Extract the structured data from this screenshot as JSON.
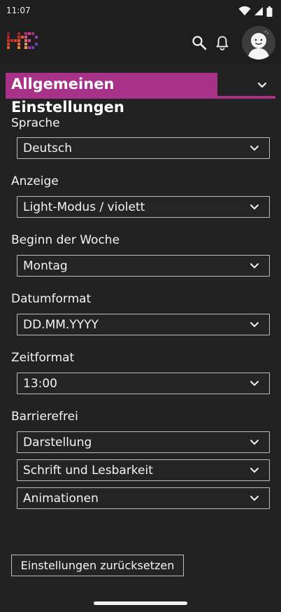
{
  "status_bar": {
    "time": "11:07"
  },
  "app_bar": {
    "icons": [
      "app-logo",
      "search-icon",
      "bell-icon",
      "avatar"
    ]
  },
  "section": {
    "title": "Allgemeinen Einstellungen"
  },
  "fields": {
    "language": {
      "label": "Sprache",
      "value": "Deutsch"
    },
    "display": {
      "label": "Anzeige",
      "value": "Light-Modus / violett"
    },
    "week_start": {
      "label": "Beginn der Woche",
      "value": "Montag"
    },
    "date_format": {
      "label": "Datumformat",
      "value": "DD.MM.YYYY"
    },
    "time_format": {
      "label": "Zeitformat",
      "value": "13:00"
    }
  },
  "accessibility": {
    "label": "Barrierefrei",
    "items": [
      "Darstellung",
      "Schrift und Lesbarkeit",
      "Animationen"
    ]
  },
  "reset_button": {
    "label": "Einstellungen zurücksetzen"
  },
  "colors": {
    "accent": "#a83287",
    "background": "#222222",
    "border": "#bdbdbd"
  }
}
